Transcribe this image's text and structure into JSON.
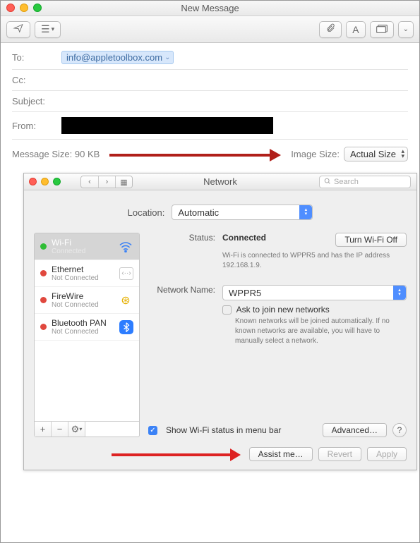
{
  "mail": {
    "title": "New Message",
    "to_label": "To:",
    "to_token": "info@appletoolbox.com",
    "cc_label": "Cc:",
    "subject_label": "Subject:",
    "from_label": "From:",
    "msg_size_label": "Message Size: 90 KB",
    "image_size_label": "Image Size:",
    "image_size_value": "Actual Size"
  },
  "network": {
    "title": "Network",
    "search_placeholder": "Search",
    "location_label": "Location:",
    "location_value": "Automatic",
    "sidebar": [
      {
        "name": "Wi-Fi",
        "sub": "Connected",
        "status": "green",
        "icon": "wifi",
        "selected": true
      },
      {
        "name": "Ethernet",
        "sub": "Not Connected",
        "status": "red",
        "icon": "eth",
        "selected": false
      },
      {
        "name": "FireWire",
        "sub": "Not Connected",
        "status": "red",
        "icon": "fw",
        "selected": false
      },
      {
        "name": "Bluetooth PAN",
        "sub": "Not Connected",
        "status": "red",
        "icon": "bt",
        "selected": false
      }
    ],
    "status_label": "Status:",
    "status_value": "Connected",
    "wifi_off_btn": "Turn Wi-Fi Off",
    "status_desc": "Wi-Fi is connected to WPPR5 and has the IP address 192.168.1.9.",
    "netname_label": "Network Name:",
    "netname_value": "WPPR5",
    "ask_join": "Ask to join new networks",
    "ask_join_desc": "Known networks will be joined automatically. If no known networks are available, you will have to manually select a network.",
    "show_status": "Show Wi-Fi status in menu bar",
    "advanced_btn": "Advanced…",
    "assist_btn": "Assist me…",
    "revert_btn": "Revert",
    "apply_btn": "Apply"
  }
}
